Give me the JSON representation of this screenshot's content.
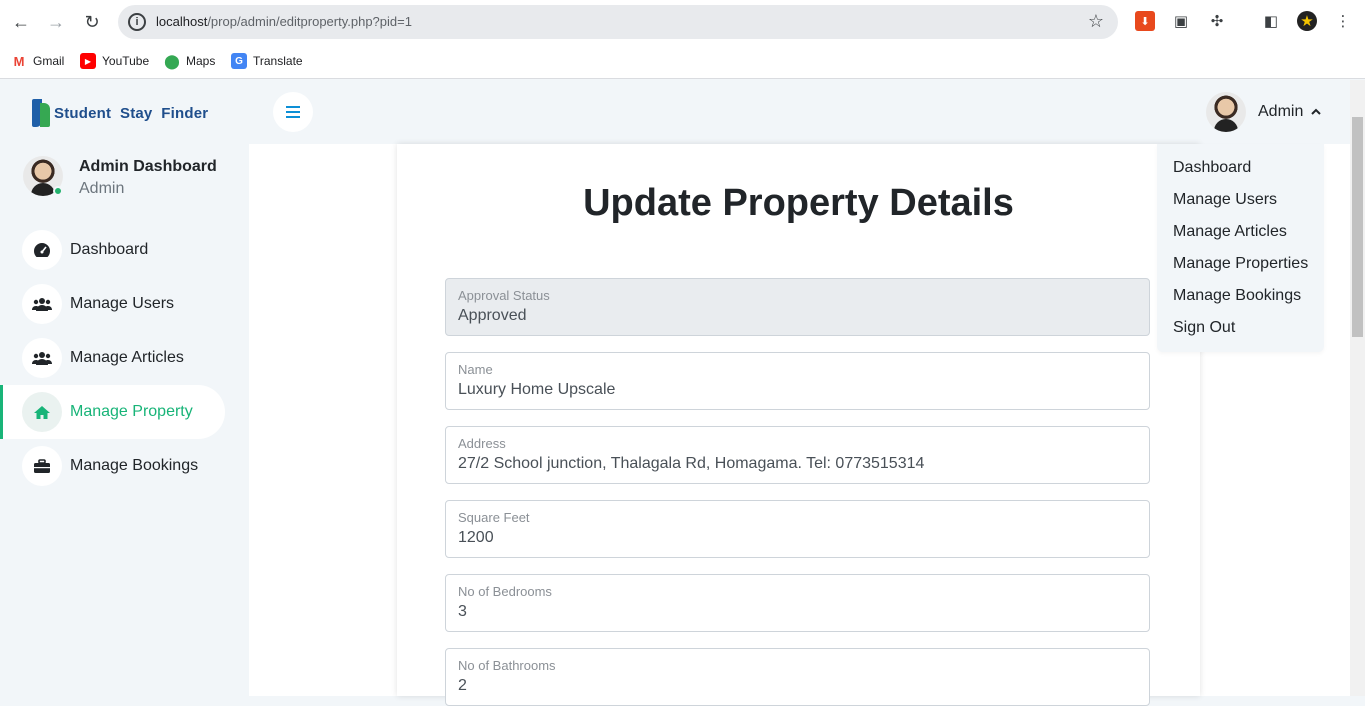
{
  "browser": {
    "url_host": "localhost",
    "url_path": "/prop/admin/editproperty.php?pid=1",
    "bookmarks": [
      {
        "label": "Gmail",
        "icon": "gmail-icon",
        "color": "#ea4335"
      },
      {
        "label": "YouTube",
        "icon": "youtube-icon",
        "color": "#ff0000"
      },
      {
        "label": "Maps",
        "icon": "maps-icon",
        "color": "#34a853"
      },
      {
        "label": "Translate",
        "icon": "translate-icon",
        "color": "#4285f4"
      }
    ]
  },
  "brand": {
    "name_part1": "Student",
    "name_part2": "Stay",
    "name_part3": "Finder"
  },
  "sidebar": {
    "profile_title": "Admin Dashboard",
    "profile_role": "Admin",
    "items": [
      {
        "label": "Dashboard",
        "icon": "dashboard-icon",
        "glyph": "◕"
      },
      {
        "label": "Manage Users",
        "icon": "users-icon",
        "glyph": "👥"
      },
      {
        "label": "Manage Articles",
        "icon": "users-icon",
        "glyph": "👥"
      },
      {
        "label": "Manage Property",
        "icon": "home-icon",
        "glyph": "⌂"
      },
      {
        "label": "Manage Bookings",
        "icon": "briefcase-icon",
        "glyph": "💼"
      }
    ],
    "active_item": "Manage Property"
  },
  "topbar": {
    "user_name": "Admin"
  },
  "dropdown": {
    "items": [
      "Dashboard",
      "Manage Users",
      "Manage Articles",
      "Manage Properties",
      "Manage Bookings",
      "Sign Out"
    ]
  },
  "form": {
    "title": "Update Property Details",
    "fields": [
      {
        "label": "Approval Status",
        "value": "Approved",
        "disabled": true
      },
      {
        "label": "Name",
        "value": "Luxury Home Upscale"
      },
      {
        "label": "Address",
        "value": "27/2 School junction, Thalagala Rd, Homagama. Tel: 0773515314"
      },
      {
        "label": "Square Feet",
        "value": "1200"
      },
      {
        "label": "No of Bedrooms",
        "value": "3"
      },
      {
        "label": "No of Bathrooms",
        "value": "2"
      }
    ]
  },
  "colors": {
    "accent": "#18b478",
    "toggle": "#0d8fd6"
  }
}
